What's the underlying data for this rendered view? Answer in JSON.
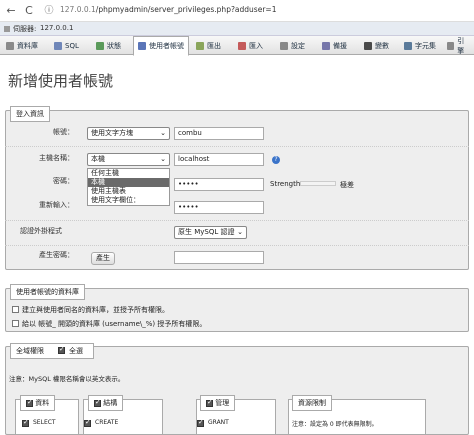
{
  "browser": {
    "back": "←",
    "refresh": "C",
    "info": "ⓘ",
    "url_host": "127.0.0.1",
    "url_path": "/phpmyadmin/server_privileges.php?adduser=1"
  },
  "breadcrumb": {
    "server_prefix": "伺服器:",
    "server": "127.0.0.1"
  },
  "tabs": [
    {
      "label": "資料庫",
      "color": "#8a8a8a"
    },
    {
      "label": "SQL",
      "color": "#6f86b8"
    },
    {
      "label": "狀態",
      "color": "#5a9a5a"
    },
    {
      "label": "使用者帳號",
      "color": "#5a75b8"
    },
    {
      "label": "匯出",
      "color": "#8aa55a"
    },
    {
      "label": "匯入",
      "color": "#c45a5a"
    },
    {
      "label": "設定",
      "color": "#888888"
    },
    {
      "label": "備援",
      "color": "#7777aa"
    },
    {
      "label": "變數",
      "color": "#4a4a4a"
    },
    {
      "label": "字元集",
      "color": "#5a7a9a"
    },
    {
      "label": "引擎",
      "color": "#888888"
    }
  ],
  "page_title": "新增使用者帳號",
  "login": {
    "legend": "登入資訊",
    "username_label": "帳號：",
    "username_mode": "使用文字方塊",
    "username_value": "combu",
    "host_label": "主機名稱：",
    "host_mode": "本機",
    "host_value": "localhost",
    "host_options": [
      "任何主機",
      "本機",
      "使用主機表",
      "使用文字欄位："
    ],
    "host_selected_index": 1,
    "password_label": "密碼：",
    "password_value": "•••••",
    "strength_label": "Strength:",
    "strength_text": "極差",
    "retype_label": "重新輸入：",
    "retype_value": "•••••",
    "auth_label": "認證外掛程式",
    "auth_value": "原生 MySQL 認證",
    "generate_label": "產生密碼：",
    "generate_button": "產生"
  },
  "database": {
    "legend": "使用者帳號的資料庫",
    "option1": "建立與使用者同名的資料庫，並授予所有權限。",
    "option2": "給以 帳號_ 開頭的資料庫 (username\\_%) 授予所有權限。"
  },
  "global": {
    "legend": "全域權限",
    "check_all": "全選",
    "note": "注意：MySQL 權限名稱會以英文表示。",
    "groups": [
      {
        "title": "資料",
        "first_item": "SELECT"
      },
      {
        "title": "結構",
        "first_item": "CREATE"
      },
      {
        "title": "管理",
        "first_item": "GRANT"
      },
      {
        "title": "資源限制",
        "first_item": "注意：設定為 0 即代表無限制。"
      }
    ]
  }
}
